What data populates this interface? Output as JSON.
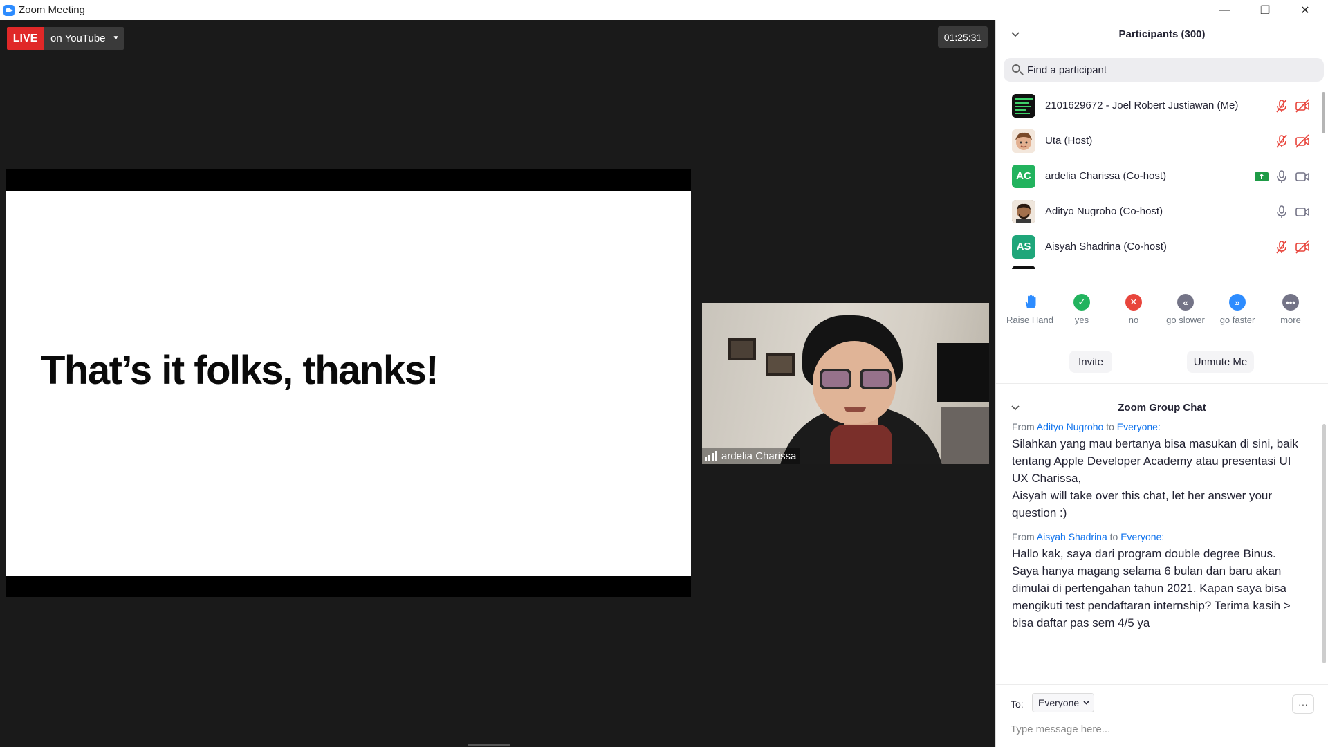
{
  "window": {
    "title": "Zoom Meeting",
    "controls": {
      "minimize": "—",
      "restore": "❐",
      "close": "✕"
    }
  },
  "stage": {
    "live_label": "LIVE",
    "live_destination": "on YouTube",
    "live_caret": "▼",
    "timer": "01:25:31",
    "slide_text": "That’s it folks, thanks!",
    "camera_name": "ardelia Charissa",
    "colors": {
      "live": "#e02828",
      "background": "#1a1a1a"
    }
  },
  "participants": {
    "header": "Participants (300)",
    "search_placeholder": "Find a participant",
    "list": [
      {
        "name": "2101629672 - Joel Robert Justiawan (Me)",
        "avatar": "",
        "avatar_color": "#1b1b1b",
        "mic": "muted",
        "video": "off"
      },
      {
        "name": "Uta (Host)",
        "avatar": "",
        "avatar_color": "#d8a47f",
        "mic": "muted",
        "video": "off"
      },
      {
        "name": "ardelia Charissa (Co-host)",
        "avatar": "AC",
        "avatar_color": "#22b35e",
        "mic": "on",
        "video": "on",
        "sharing": true
      },
      {
        "name": "Adityo Nugroho (Co-host)",
        "avatar": "",
        "avatar_color": "#6b4a34",
        "mic": "on",
        "video": "on"
      },
      {
        "name": "Aisyah Shadrina (Co-host)",
        "avatar": "AS",
        "avatar_color": "#1fa67a",
        "mic": "muted",
        "video": "off"
      }
    ],
    "reactions": [
      {
        "label": "Raise Hand",
        "icon": "hand-icon",
        "color": "#2d8cff"
      },
      {
        "label": "yes",
        "icon": "check-icon",
        "color": "#22b35e"
      },
      {
        "label": "no",
        "icon": "x-icon",
        "color": "#e8453c"
      },
      {
        "label": "go slower",
        "icon": "rewind-icon",
        "color": "#747487"
      },
      {
        "label": "go faster",
        "icon": "fast-forward-icon",
        "color": "#2d8cff"
      },
      {
        "label": "more",
        "icon": "more-icon",
        "color": "#747487"
      }
    ],
    "invite_label": "Invite",
    "unmute_label": "Unmute Me"
  },
  "chat": {
    "header": "Zoom Group Chat",
    "messages": [
      {
        "from_prefix": "From",
        "sender": "Adityo Nugroho",
        "to_prefix": "to",
        "recipient": "Everyone",
        "colon": ":",
        "text": "Silahkan yang mau bertanya bisa masukan di sini, baik tentang Apple Developer Academy atau presentasi UI UX Charissa,\nAisyah will take over this chat, let her answer your question :)"
      },
      {
        "from_prefix": "From",
        "sender": "Aisyah Shadrina",
        "to_prefix": "to",
        "recipient": "Everyone",
        "colon": ":",
        "text": "Hallo kak, saya dari program double degree Binus. Saya hanya magang selama 6 bulan dan baru akan dimulai di pertengahan tahun 2021. Kapan saya bisa mengikuti test pendaftaran internship? Terima kasih > bisa daftar pas sem 4/5 ya"
      }
    ],
    "to_label": "To:",
    "to_value": "Everyone",
    "more_label": "···",
    "input_placeholder": "Type message here..."
  }
}
